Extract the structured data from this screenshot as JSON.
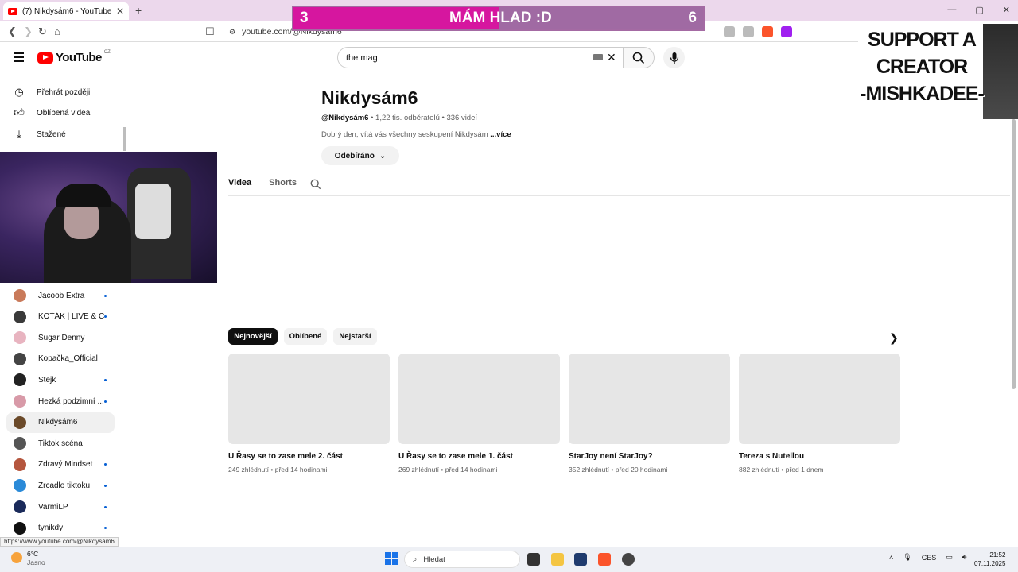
{
  "browser": {
    "tab_title": "(7) Nikdysám6 - YouTube",
    "new_tab": "+",
    "url": "youtube.com/@Nikdysam6",
    "window_controls": [
      "—",
      "▢",
      "✕"
    ]
  },
  "overlay_banner": {
    "left_number": "3",
    "text": "MÁM HLAD :D",
    "right_number": "6",
    "progress": 0.5,
    "fill_color": "#d6169f",
    "rest_color": "#a06aa3"
  },
  "support_overlay": {
    "line1": "SUPPORT A",
    "line2": "CREATOR",
    "line3": "-MISHKADEE-"
  },
  "header": {
    "logo_text": "YouTube",
    "logo_region": "CZ",
    "search_value": "the mag",
    "clear_icon": "close-icon",
    "search_icon": "search-icon",
    "mic_icon": "mic-icon"
  },
  "sidebar": {
    "items": [
      {
        "label": "Přehrát později",
        "icon": "clock-icon"
      },
      {
        "label": "Oblíbená videa",
        "icon": "thumbs-up-icon"
      },
      {
        "label": "Stažené",
        "icon": "download-icon"
      }
    ],
    "subscriptions": [
      {
        "label": "Jacoob Extra",
        "dot": true,
        "color": "#c97a5a"
      },
      {
        "label": "KOŤÁK | LIVE & C...",
        "dot": true,
        "color": "#3a3a3a"
      },
      {
        "label": "Sugar Denny",
        "dot": false,
        "color": "#e8b4c0"
      },
      {
        "label": "Kopačka_Official",
        "dot": false,
        "color": "#444444"
      },
      {
        "label": "Stejk",
        "dot": true,
        "color": "#222222"
      },
      {
        "label": "Hezká podzimní ...",
        "dot": true,
        "color": "#d89aa8"
      },
      {
        "label": "Nikdysám6",
        "dot": false,
        "color": "#6b4a2a"
      },
      {
        "label": "Tiktok scéna",
        "dot": false,
        "color": "#555555"
      },
      {
        "label": "Zdravý Mindset",
        "dot": true,
        "color": "#b5563e"
      },
      {
        "label": "Zrcadlo tiktoku",
        "dot": true,
        "color": "#2a8ad8"
      },
      {
        "label": "VarmiLP",
        "dot": true,
        "color": "#1a2a5a"
      },
      {
        "label": "tynikdy",
        "dot": true,
        "color": "#111111"
      }
    ]
  },
  "channel": {
    "name": "Nikdysám6",
    "handle": "@Nikdysám6",
    "stats": " • 1,22 tis. odběratelů • 336 videí",
    "description": "Dobrý den, vítá vás všechny seskupení Nikdysám ",
    "more": "...více",
    "subscribe_label": "Odebíráno",
    "tabs": [
      "Videa",
      "Shorts"
    ],
    "chips": [
      "Nejnovější",
      "Oblíbené",
      "Nejstarší"
    ],
    "videos": [
      {
        "title": "U Řasy se to zase mele 2. část",
        "meta": "249 zhlédnutí • před 14 hodinami"
      },
      {
        "title": "U Řasy se to zase mele 1. část",
        "meta": "269 zhlédnutí • před 14 hodinami"
      },
      {
        "title": "StarJoy není StarJoy?",
        "meta": "352 zhlédnutí • před 20 hodinami"
      },
      {
        "title": "Tereza s Nutellou",
        "meta": "882 zhlédnutí • před 1 dnem"
      }
    ]
  },
  "status_url": "https://www.youtube.com/@Nikdysám6",
  "taskbar": {
    "temp": "6°C",
    "weather": "Jasno",
    "search_placeholder": "Hledat",
    "lang": "CES",
    "time": "21:52",
    "date": "07.11.2025"
  }
}
